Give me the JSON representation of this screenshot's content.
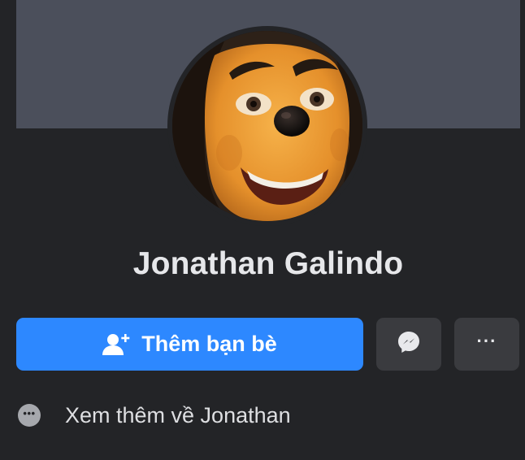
{
  "profile": {
    "name": "Jonathan Galindo"
  },
  "actions": {
    "add_friend_label": "Thêm bạn bè",
    "add_friend_icon": "person-plus-icon",
    "messenger_icon": "messenger-icon",
    "more_icon": "ellipsis-icon",
    "more_label": "···"
  },
  "about": {
    "see_more_label": "Xem thêm về Jonathan",
    "see_more_icon": "ellipsis-circle-icon"
  },
  "colors": {
    "background": "#232427",
    "cover": "#4b4f5b",
    "primary_button": "#2d88ff",
    "secondary_button": "#3a3b3f",
    "name_text": "#e6e7ea"
  }
}
